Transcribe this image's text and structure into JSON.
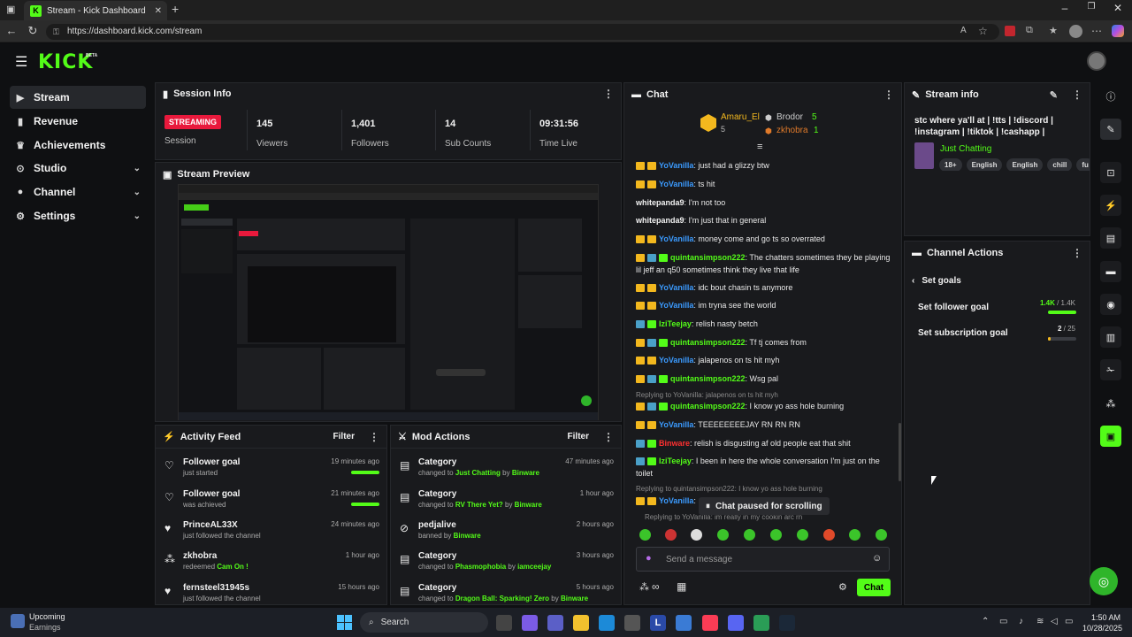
{
  "browser": {
    "tab_title": "Stream - Kick Dashboard",
    "url": "https://dashboard.kick.com/stream",
    "tab_close": "✕",
    "new_tab": "+"
  },
  "brand": {
    "logo": "KICK",
    "beta": "BETA",
    "accent": "#53fc18"
  },
  "sidebar": {
    "items": [
      {
        "label": "Stream",
        "icon": "video-icon",
        "active": true
      },
      {
        "label": "Revenue",
        "icon": "chart-icon"
      },
      {
        "label": "Achievements",
        "icon": "trophy-icon"
      },
      {
        "label": "Studio",
        "icon": "studio-icon",
        "expandable": true
      },
      {
        "label": "Channel",
        "icon": "person-icon",
        "expandable": true
      },
      {
        "label": "Settings",
        "icon": "gear-icon",
        "expandable": true
      }
    ]
  },
  "session_info": {
    "title": "Session Info",
    "status_badge": "STREAMING",
    "status_label": "Session",
    "stats": [
      {
        "value": "145",
        "label": "Viewers"
      },
      {
        "value": "1,401",
        "label": "Followers"
      },
      {
        "value": "14",
        "label": "Sub Counts"
      },
      {
        "value": "09:31:56",
        "label": "Time Live"
      }
    ]
  },
  "stream_preview": {
    "title": "Stream Preview"
  },
  "activity_feed": {
    "title": "Activity Feed",
    "filter": "Filter",
    "items": [
      {
        "title": "Follower goal",
        "sub": "just started",
        "ago": "19 minutes ago",
        "icon": "heart-outline-icon",
        "progress": 1.0
      },
      {
        "title": "Follower goal",
        "sub": "was achieved",
        "ago": "21 minutes ago",
        "icon": "heart-outline-icon",
        "progress": 1.0
      },
      {
        "title": "PrinceAL33X",
        "sub": "just followed the channel",
        "ago": "24 minutes ago",
        "icon": "heart-icon"
      },
      {
        "title": "zkhobra",
        "sub_prefix": "redeemed ",
        "sub_highlight": "Cam On !",
        "ago": "1 hour ago",
        "icon": "points-icon"
      },
      {
        "title": "fernsteel31945s",
        "sub": "just followed the channel",
        "ago": "15 hours ago",
        "icon": "heart-icon"
      }
    ]
  },
  "mod_actions": {
    "title": "Mod Actions",
    "filter": "Filter",
    "items": [
      {
        "title": "Category",
        "sub_prefix": "changed to ",
        "target": "Just Chatting",
        "by": " by ",
        "mod": "Binware",
        "ago": "47 minutes ago"
      },
      {
        "title": "Category",
        "sub_prefix": "changed to ",
        "target": "RV There Yet?",
        "by": " by ",
        "mod": "Binware",
        "ago": "1 hour ago"
      },
      {
        "title": "pedjalive",
        "sub_prefix": "banned by ",
        "target": "",
        "by": "",
        "mod": "Binware",
        "ago": "2 hours ago"
      },
      {
        "title": "Category",
        "sub_prefix": "changed to ",
        "target": "Phasmophobia",
        "by": " by ",
        "mod": "iamceejay",
        "ago": "3 hours ago"
      },
      {
        "title": "Category",
        "sub_prefix": "changed to ",
        "target": "Dragon Ball: Sparking! Zero",
        "by": " by ",
        "mod": "Binware",
        "ago": "5 hours ago"
      }
    ]
  },
  "chat": {
    "title": "Chat",
    "leaderboard": [
      {
        "name": "Amaru_El",
        "count": "5"
      },
      {
        "name": "Brodor",
        "count": "5"
      },
      {
        "name": "zkhobra",
        "count": "1"
      }
    ],
    "messages": [
      {
        "user": "YoVanilla",
        "text": ": just had a glizzy btw"
      },
      {
        "user": "YoVanilla",
        "text": ": ts hit"
      },
      {
        "user": "whitepanda9",
        "text": ": I'm not too"
      },
      {
        "user": "whitepanda9",
        "text": ": I'm just that in general"
      },
      {
        "user": "YoVanilla",
        "text": ": money come and go ts so overrated"
      },
      {
        "user": "quintansimpson222",
        "text": ": The chatters sometimes they be playing lil jeff an q50 sometimes think they live that life"
      },
      {
        "user": "YoVanilla",
        "text": ": idc bout chasin ts anymore"
      },
      {
        "user": "YoVanilla",
        "text": ": im tryna see the world"
      },
      {
        "user": "IziTeejay",
        "text": ": relish nasty betch"
      },
      {
        "user": "quintansimpson222",
        "text": ": Tf tj comes from"
      },
      {
        "user": "YoVanilla",
        "text": ": jalapenos on ts hit myh"
      },
      {
        "user": "quintansimpson222",
        "text": ": Wsg pal"
      },
      {
        "reply": "Replying to YoVanilla: jalapenos on ts hit myh"
      },
      {
        "user": "quintansimpson222",
        "text": ": I know yo ass hole burning"
      },
      {
        "user": "YoVanilla",
        "text": ": TEEEEEEEEJAY RN RN RN"
      },
      {
        "user": "Binware",
        "text": ": relish is disgusting af old people eat that shit"
      },
      {
        "user": "IziTeejay",
        "text": ": I been in here the whole conversation I'm just on the toilet"
      },
      {
        "reply": "Replying to quintansimpson222: I know yo ass hole burning"
      },
      {
        "user": "YoVanilla",
        "text": ":"
      },
      {
        "reply": "Replying to YoVanilla: im really in my cookin arc rn"
      }
    ],
    "paused_label": "Chat paused for scrolling",
    "input_placeholder": "Send a message",
    "send_label": "Chat",
    "points_label": "∞"
  },
  "stream_info": {
    "title": "Stream info",
    "stream_title": "stc where ya'll at | !tts | !discord | !instagram | !tiktok | !cashapp |",
    "category": "Just Chatting",
    "tags": [
      "18+",
      "English",
      "English",
      "chill",
      "fu"
    ]
  },
  "channel_actions": {
    "title": "Channel Actions",
    "back_label": "Set goals",
    "goals": [
      {
        "label": "Set follower goal",
        "value": "1.4K",
        "target": " / 1.4K",
        "progress": 1.0
      },
      {
        "label": "Set subscription goal",
        "value": "2",
        "target": " / 25",
        "progress": 0.08
      }
    ]
  },
  "taskbar": {
    "weather_title": "Upcoming",
    "weather_sub": "Earnings",
    "search": "Search",
    "time": "1:50 AM",
    "date": "10/28/2025"
  }
}
